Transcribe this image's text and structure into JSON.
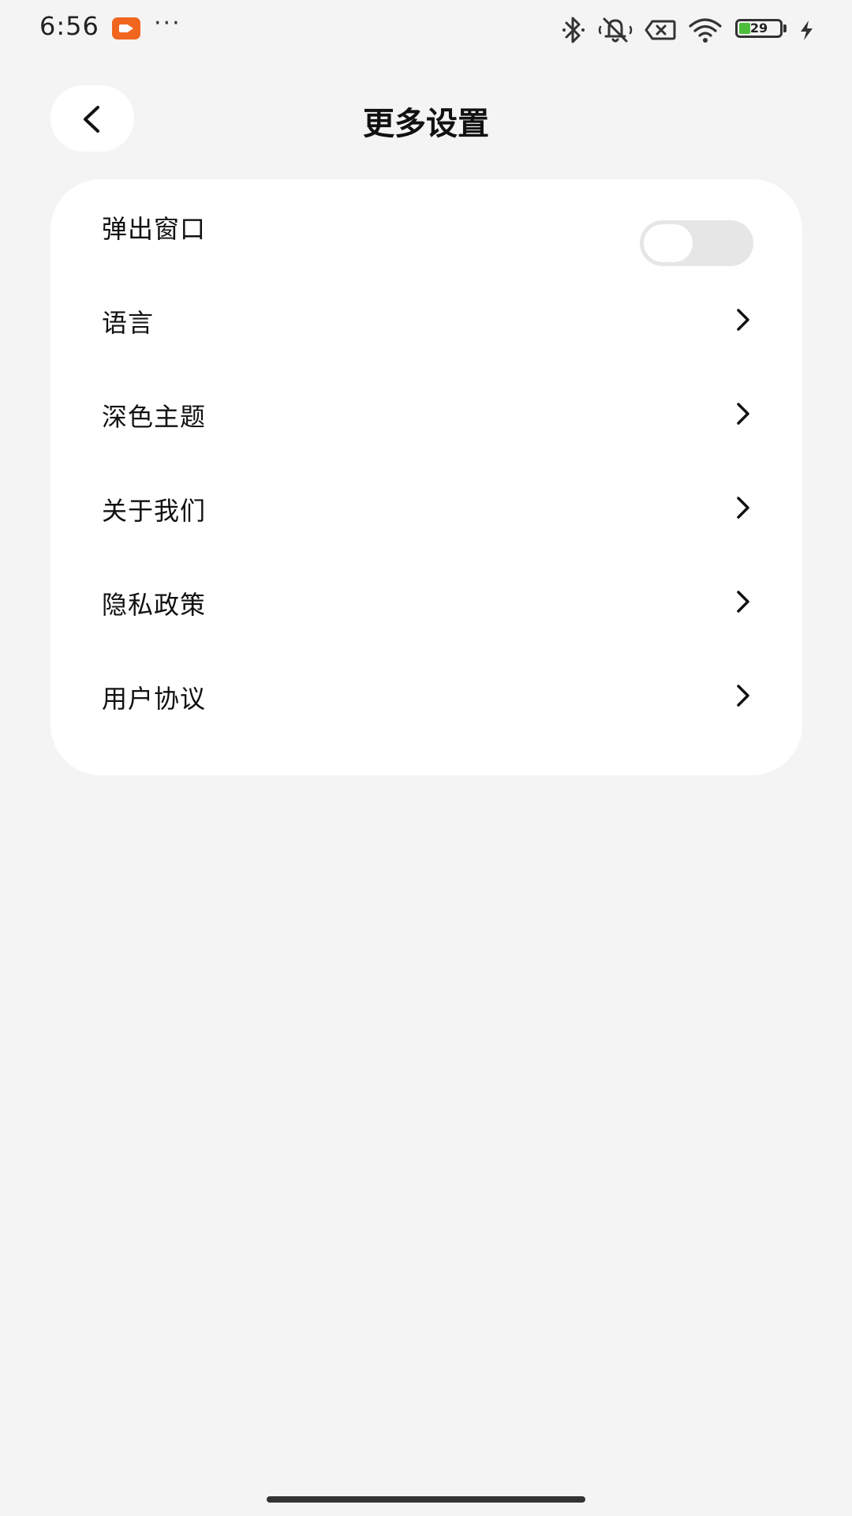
{
  "status_bar": {
    "time": "6:56",
    "more": "···",
    "battery_level": "29",
    "icons": [
      "screen-record-icon",
      "bluetooth-icon",
      "mute-icon",
      "no-sim-icon",
      "wifi-icon",
      "battery-icon",
      "charging-icon"
    ]
  },
  "header": {
    "title": "更多设置",
    "back_icon": "chevron-left-icon"
  },
  "settings": {
    "popup_window": {
      "label": "弹出窗口",
      "enabled": false
    },
    "items": [
      {
        "label": "语言"
      },
      {
        "label": "深色主题"
      },
      {
        "label": "关于我们"
      },
      {
        "label": "隐私政策"
      },
      {
        "label": "用户协议"
      }
    ]
  },
  "colors": {
    "background": "#f4f4f4",
    "card": "#ffffff",
    "toggle_off": "#e6e6e6",
    "record_accent": "#f0661f",
    "battery_fill": "#4bbf3a"
  }
}
